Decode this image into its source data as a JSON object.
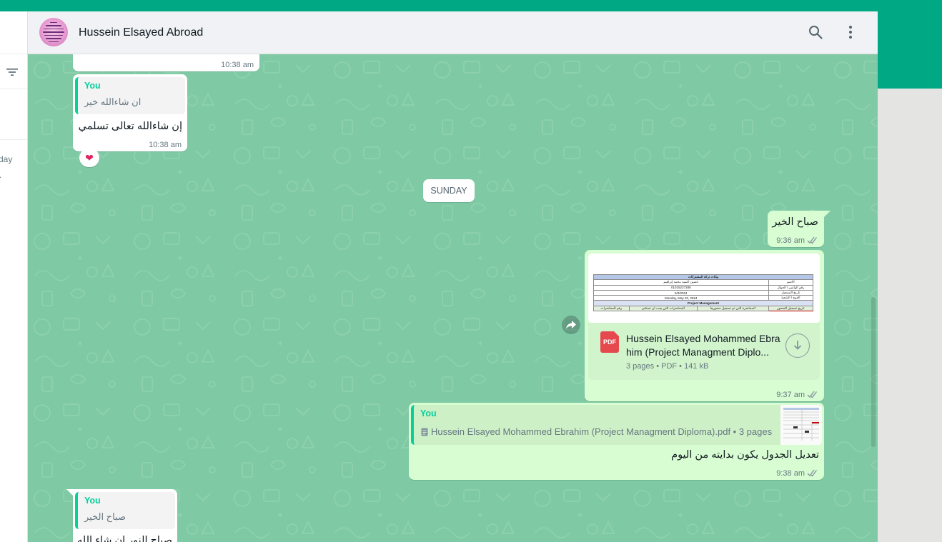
{
  "sidebar": {
    "partial_day_label": "day",
    "partial_dot": "."
  },
  "header": {
    "contact_name": "Hussein Elsayed Abroad"
  },
  "messages": {
    "m0": {
      "time": "10:38 am"
    },
    "m1": {
      "quote_author": "You",
      "quote_text": "ان شاءالله خير",
      "text": "إن شاءالله تعالى تسلمي",
      "time": "10:38 am",
      "reaction": "❤"
    },
    "day_divider": "SUNDAY",
    "m2": {
      "text": "صباح الخير",
      "time": "9:36 am"
    },
    "m3": {
      "file_name_line1": "Hussein Elsayed Mohammed Ebra",
      "file_name_line2": "him (Project Managment Diplo...",
      "file_meta": "3 pages • PDF • 141 kB",
      "file_badge": "PDF",
      "time": "9:37 am",
      "preview": {
        "title": "بيانات تركة المشتركات",
        "row1": [
          "حسين السيد محمد إبراهيم",
          "الاسم"
        ],
        "row2": [
          "01015227288",
          "رقم الواتس / الجوال"
        ],
        "row3": [
          "5/3/2024",
          "تاريخ التسجيل"
        ],
        "row4": [
          "Monday, May 20, 2024",
          "الفوج / الشعبة"
        ],
        "section": "Project Management",
        "cols": [
          "رقم المحاضرات",
          "المحاضرات التي يجب أن تستثنى",
          "المحاضرة التي تم تسجيل حضورها",
          "تاريخ تسجيل الحضور"
        ]
      }
    },
    "m4": {
      "quote_author": "You",
      "quote_file": "Hussein Elsayed Mohammed Ebrahim (Project Managment Diploma).pdf • 3 pages",
      "text": "تعديل الجدول يكون بدايته من اليوم",
      "time": "9:38 am"
    },
    "m5": {
      "quote_author": "You",
      "quote_text": "صباح الخير",
      "text_partial": "صباح النور ان شاء الله"
    }
  },
  "colors": {
    "accent": "#00a884",
    "chat_background": "#7fcaa4",
    "outgoing_bubble": "#d9fdd3",
    "quote_author": "#06cf9c",
    "pdf_icon": "#e5484d"
  }
}
